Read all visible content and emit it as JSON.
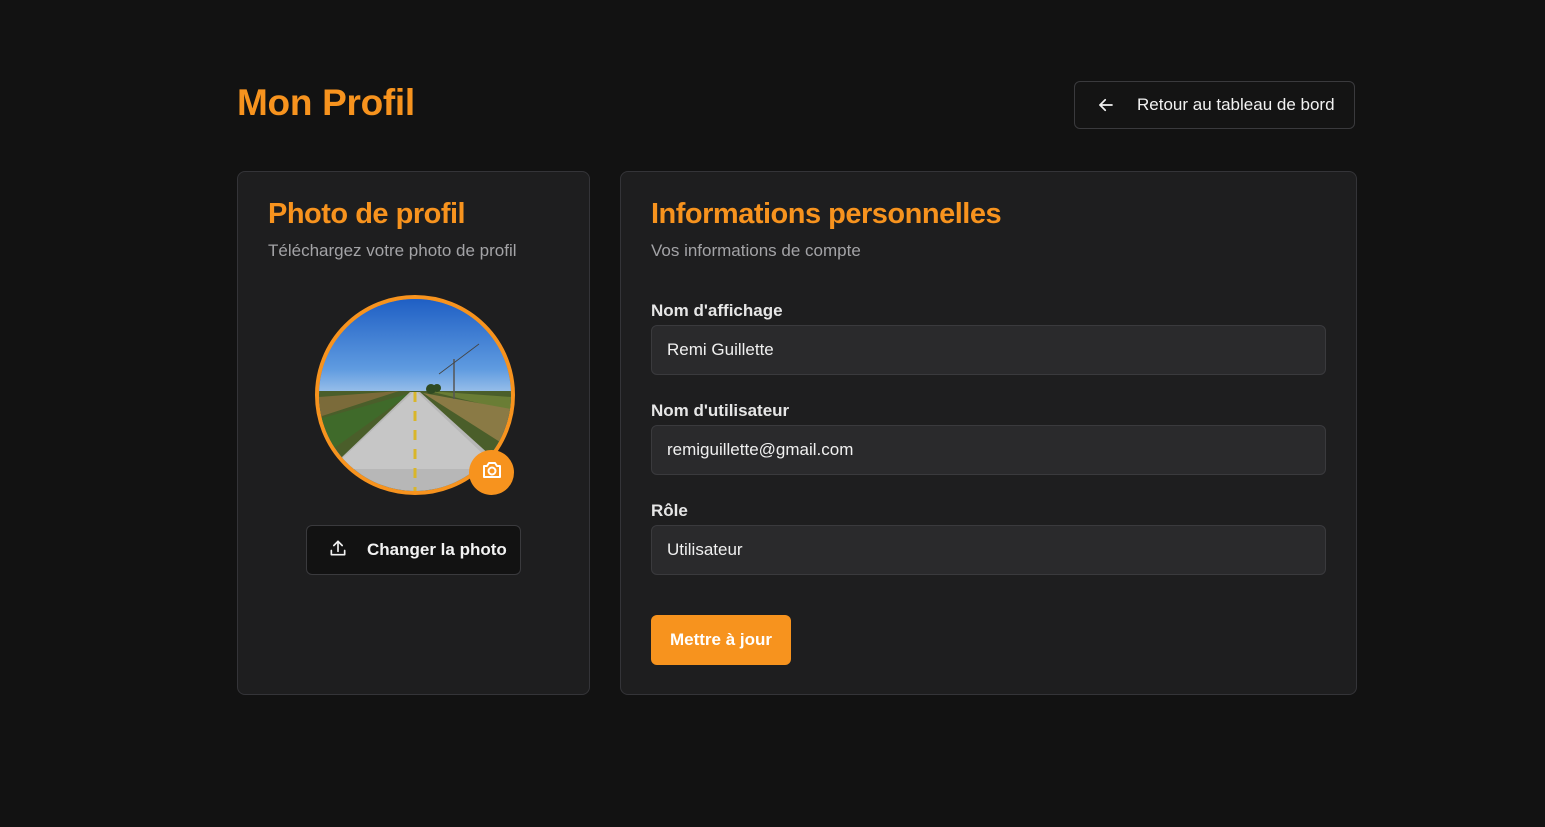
{
  "header": {
    "title": "Mon Profil",
    "back_button_label": "Retour au tableau de bord",
    "back_icon": "arrow-left-icon"
  },
  "photo_card": {
    "title": "Photo de profil",
    "subtitle": "Téléchargez votre photo de profil",
    "avatar_alt": "Photo de profil",
    "camera_icon": "camera-icon",
    "change_button_label": "Changer la photo",
    "change_button_icon": "upload-icon"
  },
  "info_card": {
    "title": "Informations personnelles",
    "subtitle": "Vos informations de compte",
    "fields": [
      {
        "label": "Nom d'affichage",
        "value": "Remi Guillette"
      },
      {
        "label": "Nom d'utilisateur",
        "value": "remiguillette@gmail.com"
      },
      {
        "label": "Rôle",
        "value": "Utilisateur"
      }
    ],
    "submit_label": "Mettre à jour"
  },
  "colors": {
    "accent": "#f7931e",
    "background": "#121212",
    "card": "#1e1e1f",
    "input": "#2a2a2c",
    "border": "#3a3a3d"
  }
}
